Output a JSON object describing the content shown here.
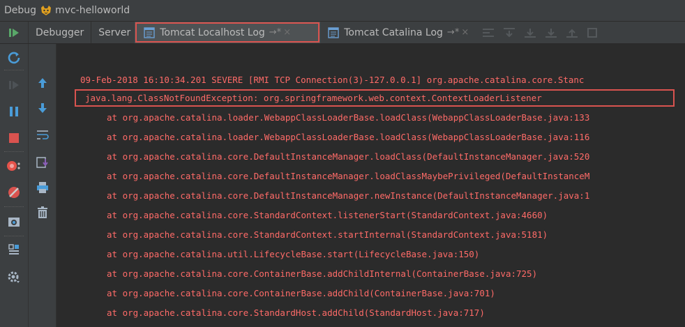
{
  "window": {
    "title": "Debug",
    "config_name": "mvc-helloworld"
  },
  "tabs": [
    {
      "label": "Debugger"
    },
    {
      "label": "Server"
    },
    {
      "label": "Tomcat Localhost Log",
      "pin": "→*",
      "close": "×",
      "active": true
    },
    {
      "label": "Tomcat Catalina Log",
      "pin": "→*",
      "close": "×"
    }
  ],
  "log": {
    "header": "09-Feb-2018 16:10:34.201 SEVERE [RMI TCP Connection(3)-127.0.0.1] org.apache.catalina.core.Stanc",
    "exception": "java.lang.ClassNotFoundException: org.springframework.web.context.ContextLoaderListener",
    "stack": [
      "at org.apache.catalina.loader.WebappClassLoaderBase.loadClass(WebappClassLoaderBase.java:133",
      "at org.apache.catalina.loader.WebappClassLoaderBase.loadClass(WebappClassLoaderBase.java:116",
      "at org.apache.catalina.core.DefaultInstanceManager.loadClass(DefaultInstanceManager.java:520",
      "at org.apache.catalina.core.DefaultInstanceManager.loadClassMaybePrivileged(DefaultInstanceM",
      "at org.apache.catalina.core.DefaultInstanceManager.newInstance(DefaultInstanceManager.java:1",
      "at org.apache.catalina.core.StandardContext.listenerStart(StandardContext.java:4660)",
      "at org.apache.catalina.core.StandardContext.startInternal(StandardContext.java:5181)",
      "at org.apache.catalina.util.LifecycleBase.start(LifecycleBase.java:150)",
      "at org.apache.catalina.core.ContainerBase.addChildInternal(ContainerBase.java:725)",
      "at org.apache.catalina.core.ContainerBase.addChild(ContainerBase.java:701)",
      "at org.apache.catalina.core.StandardHost.addChild(StandardHost.java:717)"
    ]
  },
  "colors": {
    "error_text": "#ff6b68",
    "highlight_border": "#d9534f",
    "panel_bg": "#3c3f41",
    "console_bg": "#2b2b2b"
  },
  "icons": {
    "left_toolbar": [
      "resume-icon",
      "rerun-icon",
      "step-icon",
      "pause-icon",
      "stop-icon",
      "view-breakpoints-icon",
      "mute-breakpoints-icon",
      "camera-icon",
      "layout-icon",
      "settings-icon"
    ],
    "side_toolbar": [
      "scroll-up-icon",
      "scroll-down-icon",
      "soft-wrap-icon",
      "scroll-to-end-icon",
      "print-icon",
      "clear-all-icon"
    ]
  }
}
